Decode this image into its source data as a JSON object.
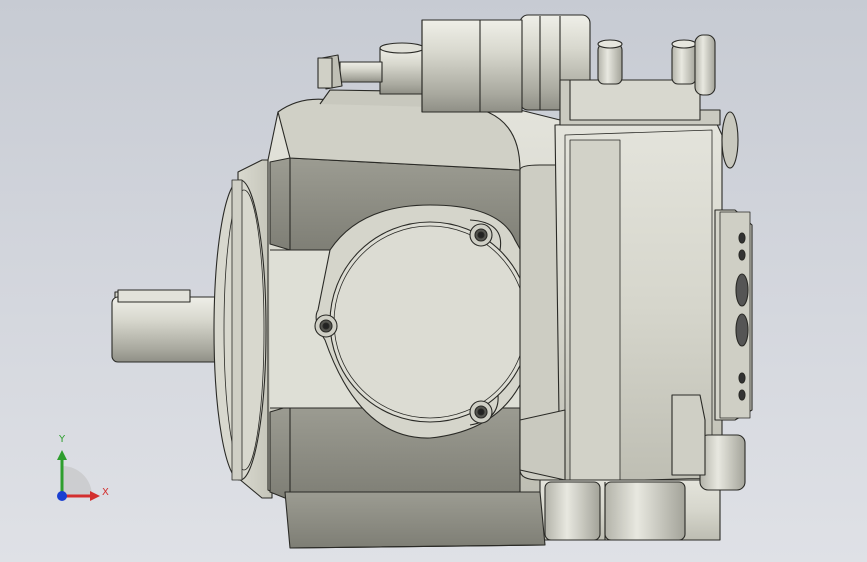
{
  "viewport": {
    "background_top": "#c7cbd3",
    "background_bottom": "#dfe1e6",
    "model": {
      "kind": "3D CAD model",
      "subject": "hydraulic-pump",
      "render_color": "#dcdcd2",
      "edge_color": "#2a2a26"
    }
  },
  "triad": {
    "x_label": "X",
    "y_label": "Y",
    "x_color": "#d32f2f",
    "y_color": "#2e9e2e",
    "z_color": "#1a3fd1"
  }
}
